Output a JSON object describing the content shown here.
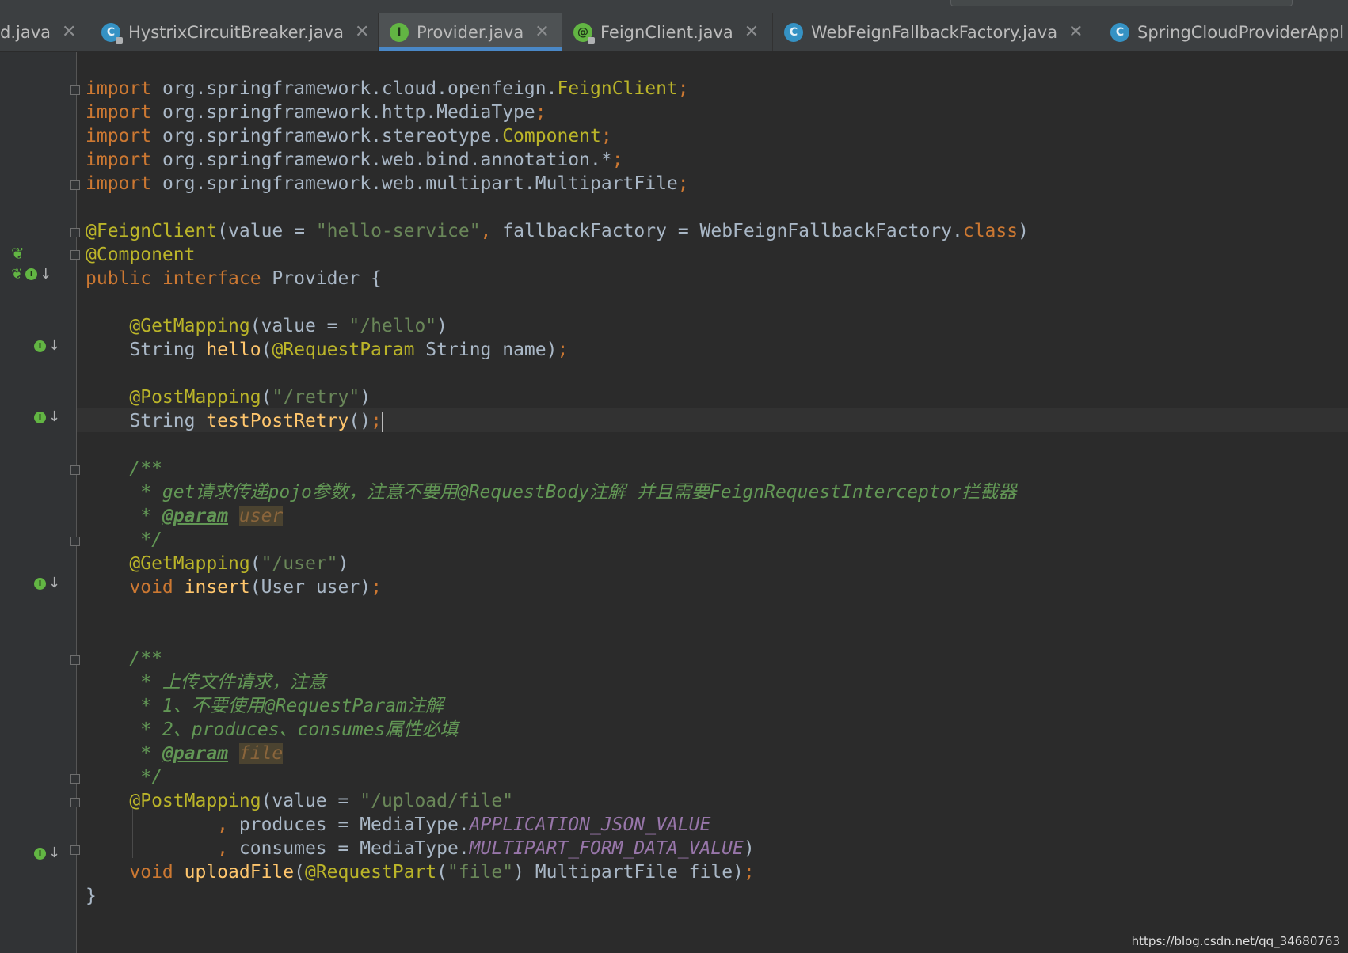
{
  "tabs": [
    {
      "label": "d.java",
      "icon": "none",
      "active": false
    },
    {
      "label": "HystrixCircuitBreaker.java",
      "icon": "class-icon",
      "active": false
    },
    {
      "label": "Provider.java",
      "icon": "interface-icon",
      "active": true
    },
    {
      "label": "FeignClient.java",
      "icon": "annotation-icon",
      "active": false
    },
    {
      "label": "WebFeignFallbackFactory.java",
      "icon": "class-icon",
      "active": false
    },
    {
      "label": "SpringCloudProviderAppl",
      "icon": "spring-app-icon",
      "active": false
    }
  ],
  "code": {
    "imp1": "import",
    "imp1_pkg": " org.springframework.cloud.openfeign.",
    "imp1_cls": "FeignClient",
    "imp1_end": ";",
    "imp2": "import",
    "imp2_pkg": " org.springframework.http.MediaType",
    "imp2_end": ";",
    "imp3": "import",
    "imp3_pkg": " org.springframework.stereotype.",
    "imp3_cls": "Component",
    "imp3_end": ";",
    "imp4": "import",
    "imp4_pkg": " org.springframework.web.bind.annotation.*",
    "imp4_end": ";",
    "imp5": "import",
    "imp5_pkg": " org.springframework.web.multipart.MultipartFile",
    "imp5_end": ";",
    "fc_ann": "@FeignClient",
    "fc_p1": "(",
    "fc_value": "value",
    "fc_eq1": " = ",
    "fc_str": "\"hello-service\"",
    "fc_comma": ", ",
    "fc_fb": "fallbackFactory",
    "fc_eq2": " = WebFeignFallbackFactory.",
    "fc_class": "class",
    "fc_p2": ")",
    "comp_ann": "@Component",
    "pub": "public",
    "sp1": " ",
    "iface": "interface",
    "iface_name": " Provider {",
    "gm1_ann": "@GetMapping",
    "gm1_p1": "(",
    "gm1_val": "value",
    "gm1_eq": " = ",
    "gm1_str": "\"/hello\"",
    "gm1_p2": ")",
    "hello_type": "String ",
    "hello_fn": "hello",
    "hello_p1": "(",
    "hello_ann": "@RequestParam",
    "hello_rest": " String name)",
    "hello_end": ";",
    "pm1_ann": "@PostMapping",
    "pm1_p1": "(",
    "pm1_str": "\"/retry\"",
    "pm1_p2": ")",
    "retry_type": "String ",
    "retry_fn": "testPostRetry",
    "retry_par": "()",
    "retry_end": ";",
    "c1_open": "/**",
    "c1_l1a": " * get请求传递pojo参数，注意不要用@RequestBody注解 并且需要FeignRequestInterceptor拦截器",
    "c1_l2a": " * ",
    "c1_tag": "@param",
    "c1_sp": " ",
    "c1_prm": "user",
    "c1_close": " */",
    "gm2_ann": "@GetMapping",
    "gm2_p1": "(",
    "gm2_str": "\"/user\"",
    "gm2_p2": ")",
    "ins_kw": "void",
    "ins_sp": " ",
    "ins_fn": "insert",
    "ins_rest": "(User user)",
    "ins_end": ";",
    "c2_open": "/**",
    "c2_l1": " * 上传文件请求，注意",
    "c2_l2": " * 1、不要使用@RequestParam注解",
    "c2_l3": " * 2、produces、consumes属性必填",
    "c2_l4a": " * ",
    "c2_tag": "@param",
    "c2_sp": " ",
    "c2_prm": "file",
    "c2_close": " */",
    "pm2_ann": "@PostMapping",
    "pm2_p1": "(",
    "pm2_val": "value",
    "pm2_eq": " = ",
    "pm2_str": "\"/upload/file\"",
    "prod_comma": ",",
    "prod_name": " produces",
    "prod_eq": " = MediaType.",
    "prod_cst": "APPLICATION_JSON_VALUE",
    "cons_comma": ",",
    "cons_name": " consumes",
    "cons_eq": " = MediaType.",
    "cons_cst": "MULTIPART_FORM_DATA_VALUE",
    "cons_p": ")",
    "up_kw": "void",
    "up_sp": " ",
    "up_fn": "uploadFile",
    "up_p1": "(",
    "up_ann": "@RequestPart",
    "up_p2": "(",
    "up_str": "\"file\"",
    "up_rest": ") MultipartFile file)",
    "up_end": ";",
    "close_brace": "}"
  },
  "watermark": "https://blog.csdn.net/qq_34680763",
  "colors": {
    "background": "#2b2b2b",
    "keyword": "#cc7832",
    "annotation": "#bbb529",
    "string": "#6a8759",
    "function": "#ffc66d",
    "comment": "#629755",
    "constant": "#9876aa",
    "tab_underline": "#4a88c7"
  }
}
